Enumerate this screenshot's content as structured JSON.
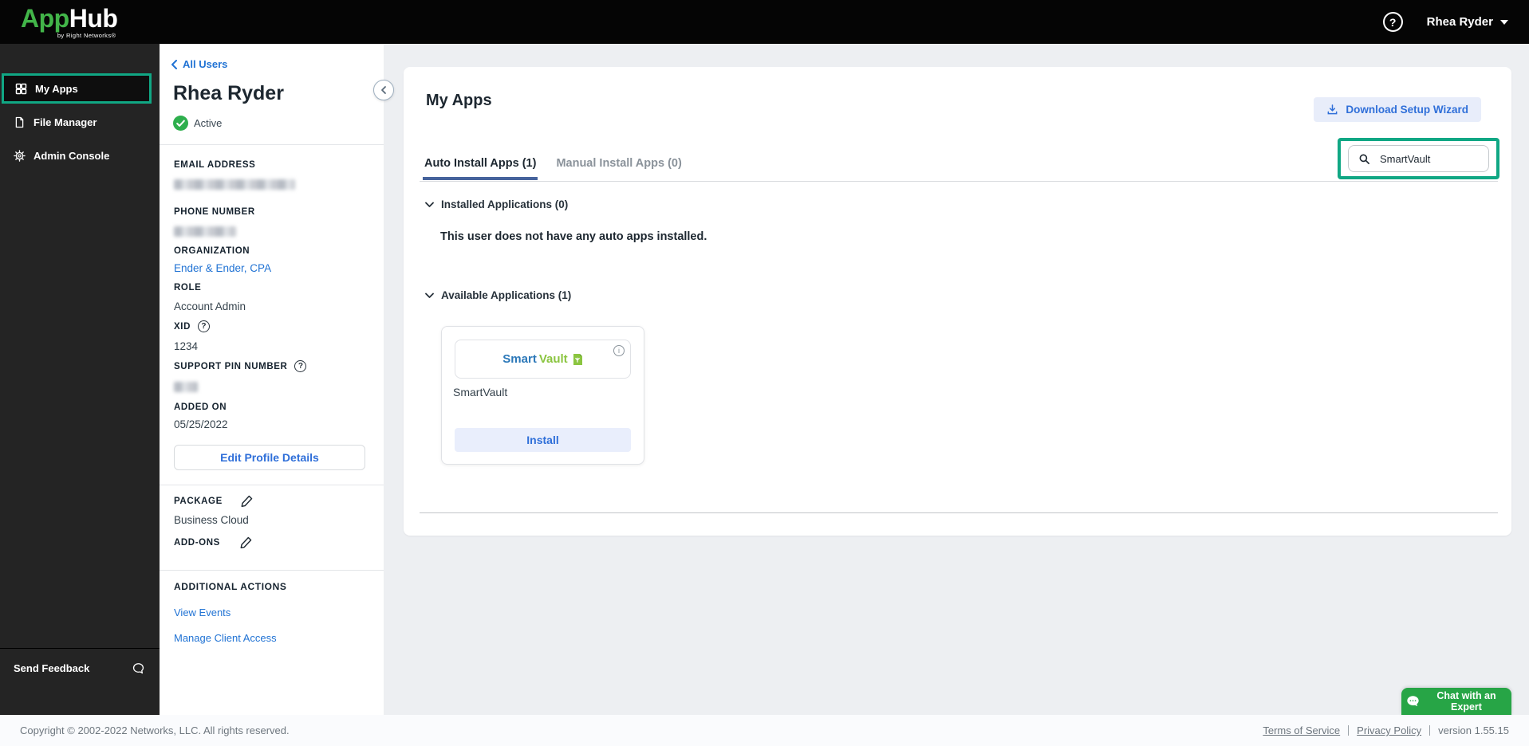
{
  "colors": {
    "annotation_teal": "#10A784",
    "chat_green": "#27A546",
    "link_blue": "#2173D4",
    "tab_underline_blue": "#46639C",
    "logo_green": "#42B549",
    "status_green": "#2EAF4D",
    "smartvault_blue": "#2A77B8",
    "smartvault_green": "#8BC540"
  },
  "header": {
    "logo": {
      "app": "App",
      "hub": "Hub",
      "byline": "by Right Networks®"
    },
    "help_glyph": "?",
    "user_name": "Rhea Ryder"
  },
  "sidebar": {
    "items": [
      {
        "label": "My Apps",
        "icon": "grid-icon",
        "active": true
      },
      {
        "label": "File Manager",
        "icon": "file-icon",
        "active": false
      },
      {
        "label": "Admin Console",
        "icon": "gear-icon",
        "active": false
      }
    ],
    "feedback_label": "Send Feedback"
  },
  "profile": {
    "back_link": "All Users",
    "name": "Rhea Ryder",
    "status": "Active",
    "email_label": "EMAIL ADDRESS",
    "phone_label": "PHONE NUMBER",
    "organization_label": "ORGANIZATION",
    "organization_value": "Ender & Ender, CPA",
    "role_label": "ROLE",
    "role_value": "Account Admin",
    "xid_label": "XID",
    "xid_value": "1234",
    "pin_label": "SUPPORT PIN NUMBER",
    "added_on_label": "ADDED ON",
    "added_on_value": "05/25/2022",
    "edit_button": "Edit Profile Details",
    "package_label": "PACKAGE",
    "package_value": "Business Cloud",
    "addons_label": "ADD-ONS",
    "additional_actions_label": "ADDITIONAL ACTIONS",
    "actions": [
      {
        "label": "View Events"
      },
      {
        "label": "Manage Client Access"
      }
    ]
  },
  "main": {
    "title": "My Apps",
    "download_button": "Download Setup Wizard",
    "search_value": "SmartVault",
    "tabs": [
      {
        "label": "Auto Install Apps (1)",
        "active": true
      },
      {
        "label": "Manual Install Apps (0)",
        "active": false
      }
    ],
    "installed_section_title": "Installed Applications (0)",
    "installed_empty_text": "This user does not have any auto apps installed.",
    "available_section_title": "Available Applications (1)",
    "app_card": {
      "logo_smart": "Smart",
      "logo_vault": "Vault",
      "name": "SmartVault",
      "install_button": "Install",
      "info_glyph": "i"
    }
  },
  "footer": {
    "copyright": "Copyright © 2002-2022 Networks, LLC. All rights reserved.",
    "links": [
      {
        "label": "Terms of Service"
      },
      {
        "label": "Privacy Policy"
      }
    ],
    "version": "version 1.55.15"
  },
  "chat_button": {
    "label": "Chat with an Expert"
  }
}
